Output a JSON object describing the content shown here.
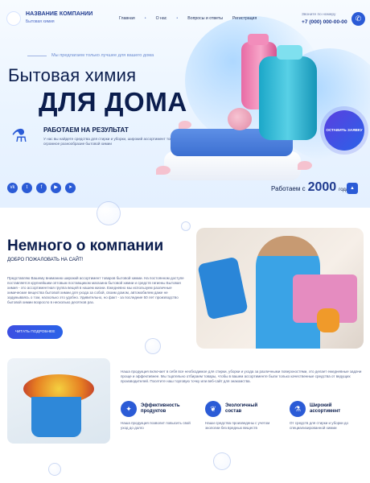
{
  "header": {
    "company_title": "НАЗВАНИЕ КОМПАНИИ",
    "company_sub": "Бытовая химия",
    "nav": [
      "Главная",
      "О нас",
      "Вопросы и ответы",
      "Регистрация"
    ],
    "phone_label": "Звоните по номеру",
    "phone": "+7 (000) 000-00-00"
  },
  "hero": {
    "tagline": "Мы предлагаем только лучшее для вашего дома",
    "title_line1": "Бытовая химия",
    "title_line2": "ДЛЯ ДОМА",
    "result_title": "РАБОТАЕМ НА РЕЗУЛЬТАТ",
    "result_text": "У нас вы найдете средства для стирки и уборки, широкий ассортимент товаров бытовой химии огромное разнообразие бытовой химии",
    "order_button": "ОСТАВИТЬ ЗАЯВКУ",
    "since_word": "Работаем с",
    "since_year": "2000",
    "since_suffix": "года",
    "socials": [
      "vk-icon",
      "twitter-icon",
      "facebook-icon",
      "youtube-icon",
      "telegram-icon"
    ],
    "up_icon": "arrow-up-icon"
  },
  "about": {
    "title": "Немного о компании",
    "subtitle": "ДОБРО ПОЖАЛОВАТЬ НА САЙТ!",
    "text": "Представляю Вашему вниманию широкий ассортимент товаров бытовой химии. На постоянном доступе поставляется крупнейшим оптовым поставщиком магазина бытовой химии и средств гигиены Бытовая химия - это ассортиментная группа вещей в нашем жизни. Ежедневно мы используем различные химические вещества бытовой химии для ухода за собой, своим домом, автомобилем даже не задумываясь о том, насколько это удобно. Удивительно, но факт - за последние 50 лет производство бытовой химии возросло в несколько десятков раз.",
    "button": "ЧИТАТЬ ПОДРОБНЕЕ"
  },
  "features": {
    "text": "Наша продукция включает в себя все необходимое для стирки, уборки и ухода за различными поверхностями, это делает ежедневные задачи проще и эффективнее. Мы тщательно отбираем товары, чтобы в вашем ассортименте были только качественные средства от ведущих производителей. Посетите наш торговую точку или веб-сайт для знакомства.",
    "items": [
      {
        "icon": "sparkle-icon",
        "title_1": "Эффективность",
        "title_2": "продуктов",
        "desc": "Наша продукция позволит повысить свой уход до долго"
      },
      {
        "icon": "leaf-icon",
        "title_1": "Экологичный",
        "title_2": "состав",
        "desc": "Наши средства произведены с учетом экологии без вредных веществ"
      },
      {
        "icon": "flask-icon",
        "title_1": "Широкий",
        "title_2": "ассортимент",
        "desc": "От средств для стирки и уборки до специализированной химии"
      }
    ]
  },
  "colors": {
    "accent": "#2b5bd6",
    "dark_text": "#0b1d4d",
    "order_button_gradient": [
      "#5a3fe0",
      "#2a62e8"
    ]
  }
}
